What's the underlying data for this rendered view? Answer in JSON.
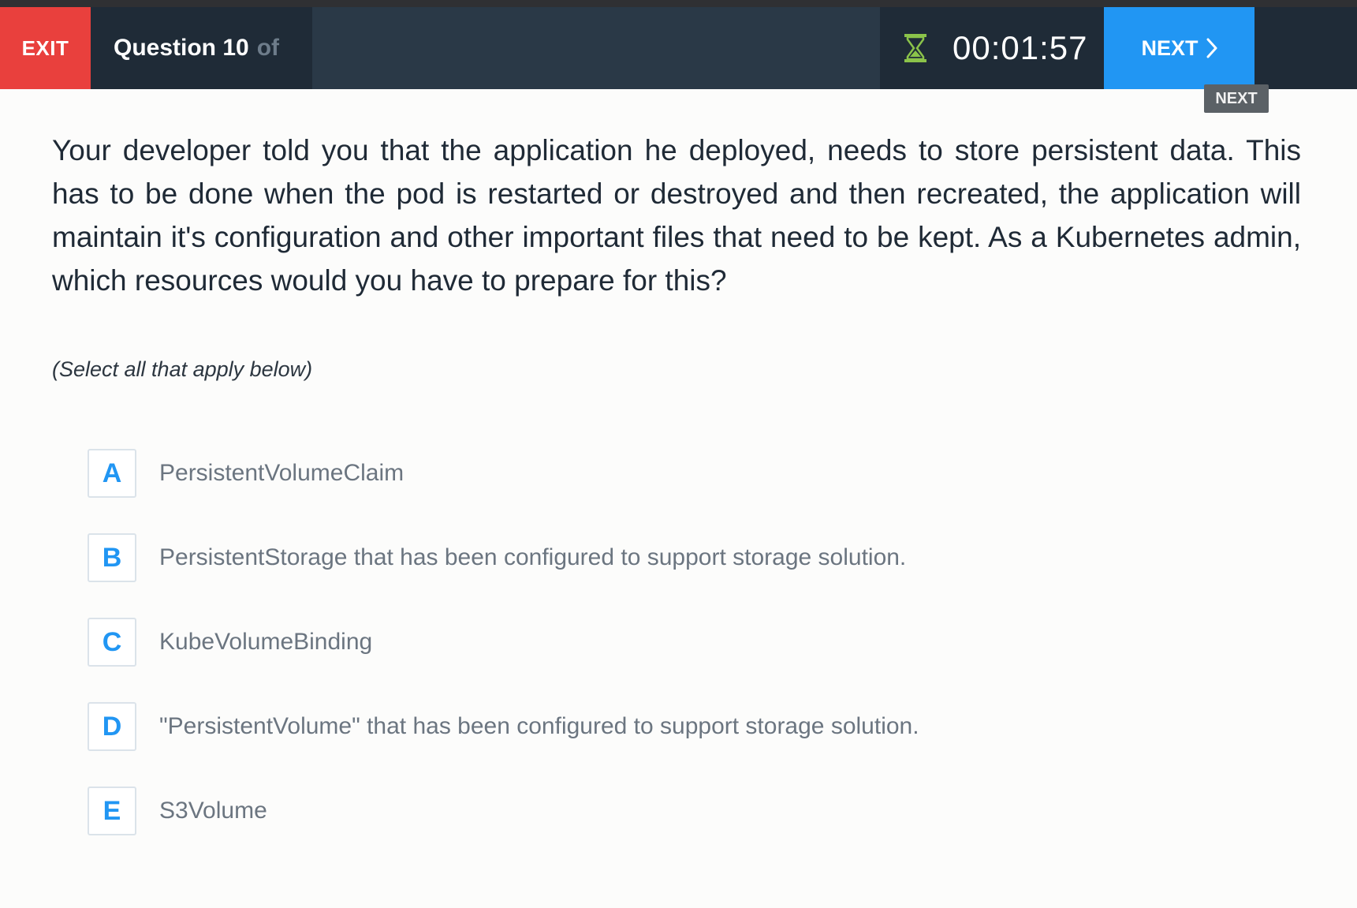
{
  "header": {
    "exit_label": "EXIT",
    "question_counter": "Question 10",
    "question_counter_suffix": "of",
    "timer": "00:01:57",
    "next_label": "NEXT",
    "next_tooltip": "NEXT",
    "timer_icon": "hourglass-icon",
    "next_icon": "chevron-right-icon",
    "colors": {
      "exit": "#e9403d",
      "next": "#2196f3",
      "bar": "#1f2b37",
      "hourglass": "#8bc34a"
    }
  },
  "question": {
    "text": "Your developer told you that the application he deployed, needs to store persistent data. This has to be done when the pod is restarted or destroyed and then recreated, the application will maintain it's configuration and other important files that need to be kept. As a Kubernetes admin, which resources would you have to prepare for this?",
    "instruction": "(Select all that apply below)"
  },
  "options": [
    {
      "key": "A",
      "label": "PersistentVolumeClaim"
    },
    {
      "key": "B",
      "label": "PersistentStorage that has been configured to support storage solution."
    },
    {
      "key": "C",
      "label": "KubeVolumeBinding"
    },
    {
      "key": "D",
      "label": "\"PersistentVolume\" that has been configured to support storage solution."
    },
    {
      "key": "E",
      "label": "S3Volume"
    }
  ]
}
